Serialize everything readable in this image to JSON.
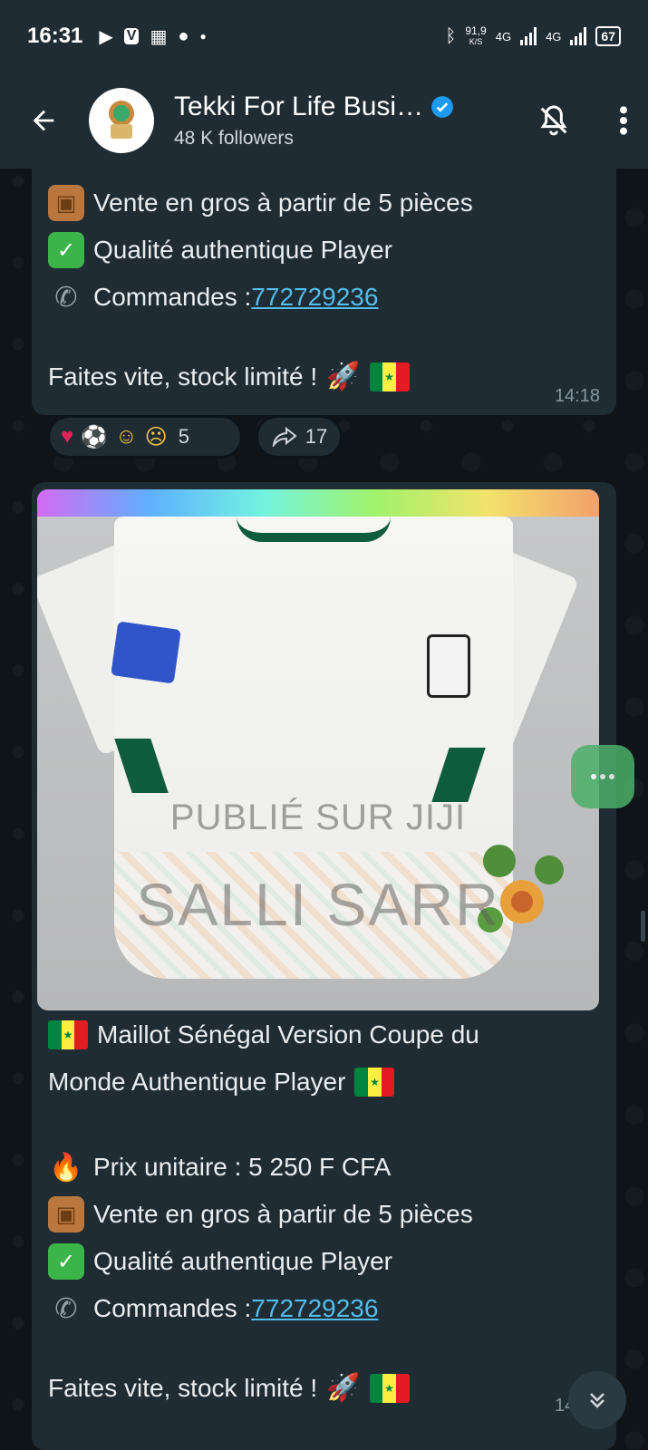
{
  "status_bar": {
    "time": "16:31",
    "net_speed": "91,9",
    "net_unit": "K/S",
    "net1": "4G",
    "net2": "4G",
    "battery": "67"
  },
  "header": {
    "channel_name": "Tekki For Life Busi…",
    "followers": "48 K followers"
  },
  "message_1": {
    "line_wholesale": "Vente en gros à partir de 5 pièces",
    "line_quality": "Qualité authentique Player",
    "orders_label": "Commandes : ",
    "orders_phone": "772729236",
    "line_hurry": "Faites vite, stock limité !",
    "time": "14:18",
    "reactions_count": "5",
    "forwards_count": "17"
  },
  "message_2": {
    "watermark_1": "PUBLIÉ SUR JIJI",
    "watermark_2": "SALLI SARR",
    "title_line_1": "Maillot Sénégal Version Coupe du",
    "title_line_2": "Monde Authentique Player",
    "price": "Prix unitaire : 5 250 F CFA",
    "line_wholesale": "Vente en gros à partir de 5 pièces",
    "line_quality": "Qualité authentique Player",
    "orders_label": "Commandes : ",
    "orders_phone": "772729236",
    "line_hurry": "Faites vite, stock limité !",
    "time": "14:18"
  },
  "colors": {
    "background": "#0b141a",
    "bubble": "#1f2c34",
    "link": "#53bdeb",
    "verified": "#1d9bf0"
  },
  "icons": [
    "back-arrow-icon",
    "verified-badge-icon",
    "mute-bell-icon",
    "more-vert-icon",
    "forward-icon",
    "scroll-down-icon"
  ]
}
